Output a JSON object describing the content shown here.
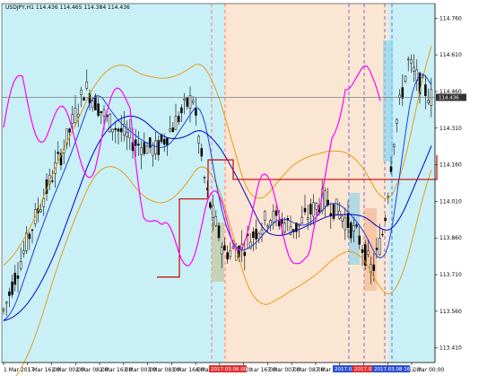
{
  "chart_data": {
    "type": "candlestick",
    "title": "USDJPY,H1  114.436 114.465 114.384 114.436",
    "y_ticks": [
      "114.760",
      "114.610",
      "114.460",
      "114.310",
      "114.160",
      "114.010",
      "113.860",
      "113.710",
      "113.560",
      "113.410"
    ],
    "current_price": "114.436",
    "x_ticks": [
      "1 Mar 2017",
      "1 Mar 16:00",
      "2 Mar 00:00",
      "2 Mar 08:00",
      "2 Mar 16:00",
      "3 Mar 00:00",
      "3 Mar 08:00",
      "3 Mar 16:00",
      "6 Mar 00:00",
      "6 Mar 08:00",
      "6 Mar 16:00",
      "7 Mar 00:00",
      "7 Mar 08:00",
      "7 Mar 16:00",
      "8 Mar 00:00",
      "8 Mar 08:00",
      "8 Mar 16:00",
      "9 Mar 00:00"
    ],
    "marker_labels": [
      "2017.03.06 00:00",
      "2017.03.08 00:00",
      "2017.03.08 08:00",
      "2017.03.08 16:00"
    ],
    "ylim": [
      113.35,
      114.82
    ],
    "grid": false,
    "colors": {
      "background": "#ffffff",
      "kumo_bull_fill": "#c9f0f7",
      "kumo_bear_fill": "#fbe6d3",
      "candle": "#000000",
      "tenkan": "#00008b",
      "kijun_up": "#cc0000",
      "kijun": "#cc0000",
      "chikou": "#ff00ff",
      "bollinger": "#e69500",
      "ma_fast": "#1f3fd6",
      "ma_slow": "#0000cc",
      "price_line": "#7a7a7a"
    }
  }
}
